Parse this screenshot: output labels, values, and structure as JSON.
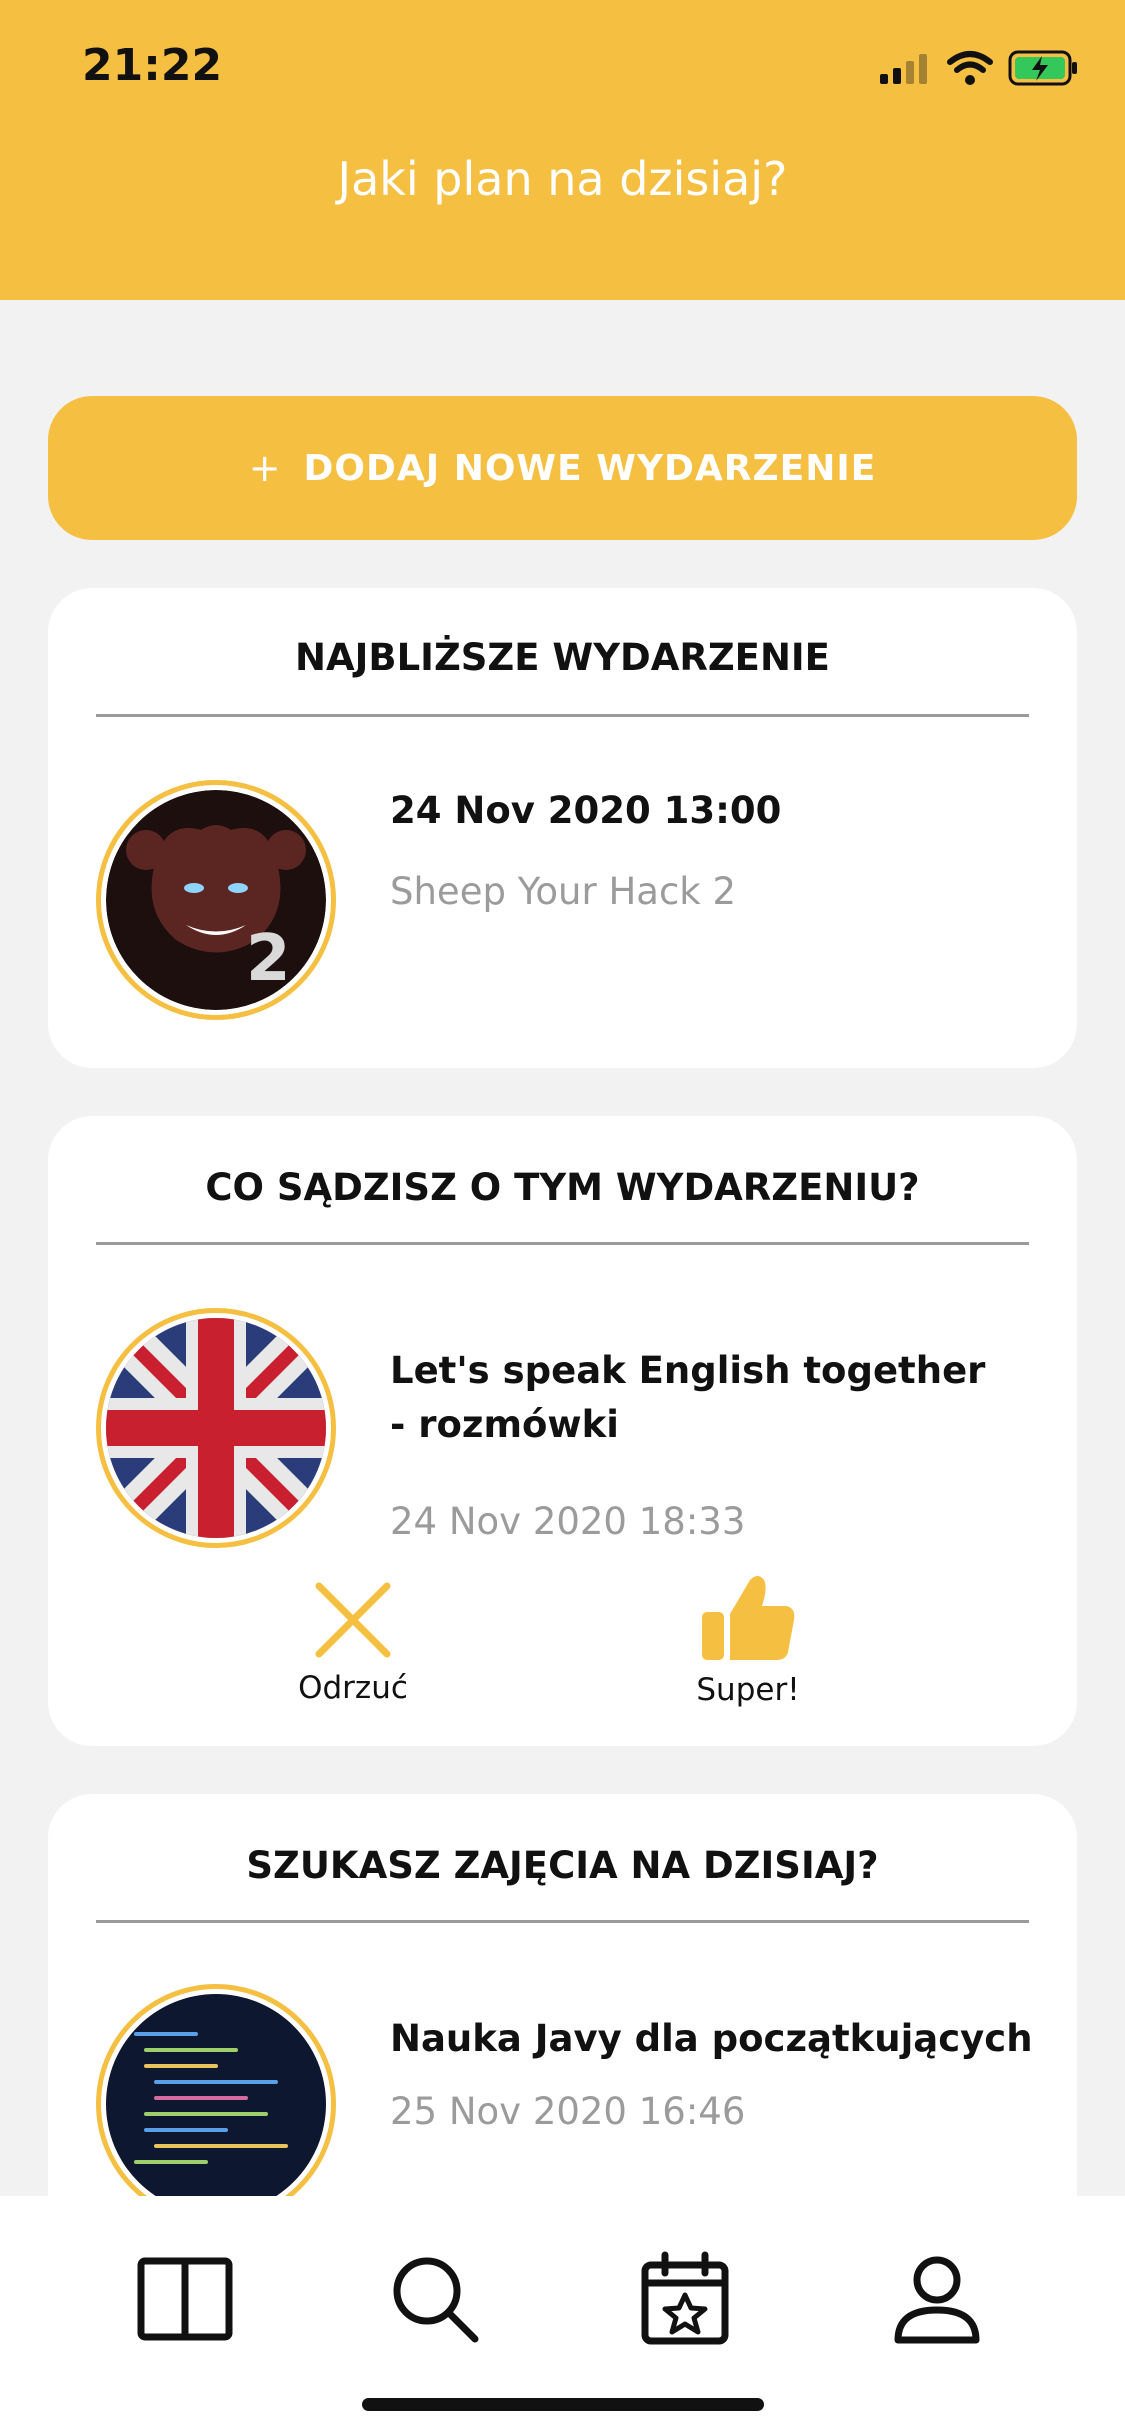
{
  "status_bar": {
    "time": "21:22"
  },
  "header": {
    "title": "Jaki plan na dzisiaj?"
  },
  "add_button": {
    "plus": "+",
    "label": "DODAJ NOWE WYDARZENIE"
  },
  "nearest_event": {
    "heading": "NAJBLIŻSZE WYDARZENIE",
    "datetime": "24 Nov 2020  13:00",
    "name": "Sheep Your Hack 2"
  },
  "opinion_event": {
    "heading": "CO SĄDZISZ O TYM WYDARZENIU?",
    "title_line1": "Let's speak English together",
    "title_line2": "- rozmówki",
    "datetime": "24 Nov 2020  18:33",
    "reject_label": "Odrzuć",
    "like_label": "Super!"
  },
  "today_search": {
    "heading": "SZUKASZ ZAJĘCIA NA DZISIAJ?",
    "title": "Nauka Javy dla początkujących",
    "datetime": "25 Nov 2020  16:46"
  },
  "tab_bar": {
    "tabs": [
      "dashboard-icon",
      "search-icon",
      "calendar-star-icon",
      "profile-icon"
    ]
  },
  "colors": {
    "accent": "#f5bf42",
    "muted_text": "#9b9b9b",
    "background": "#f2f2f2"
  }
}
